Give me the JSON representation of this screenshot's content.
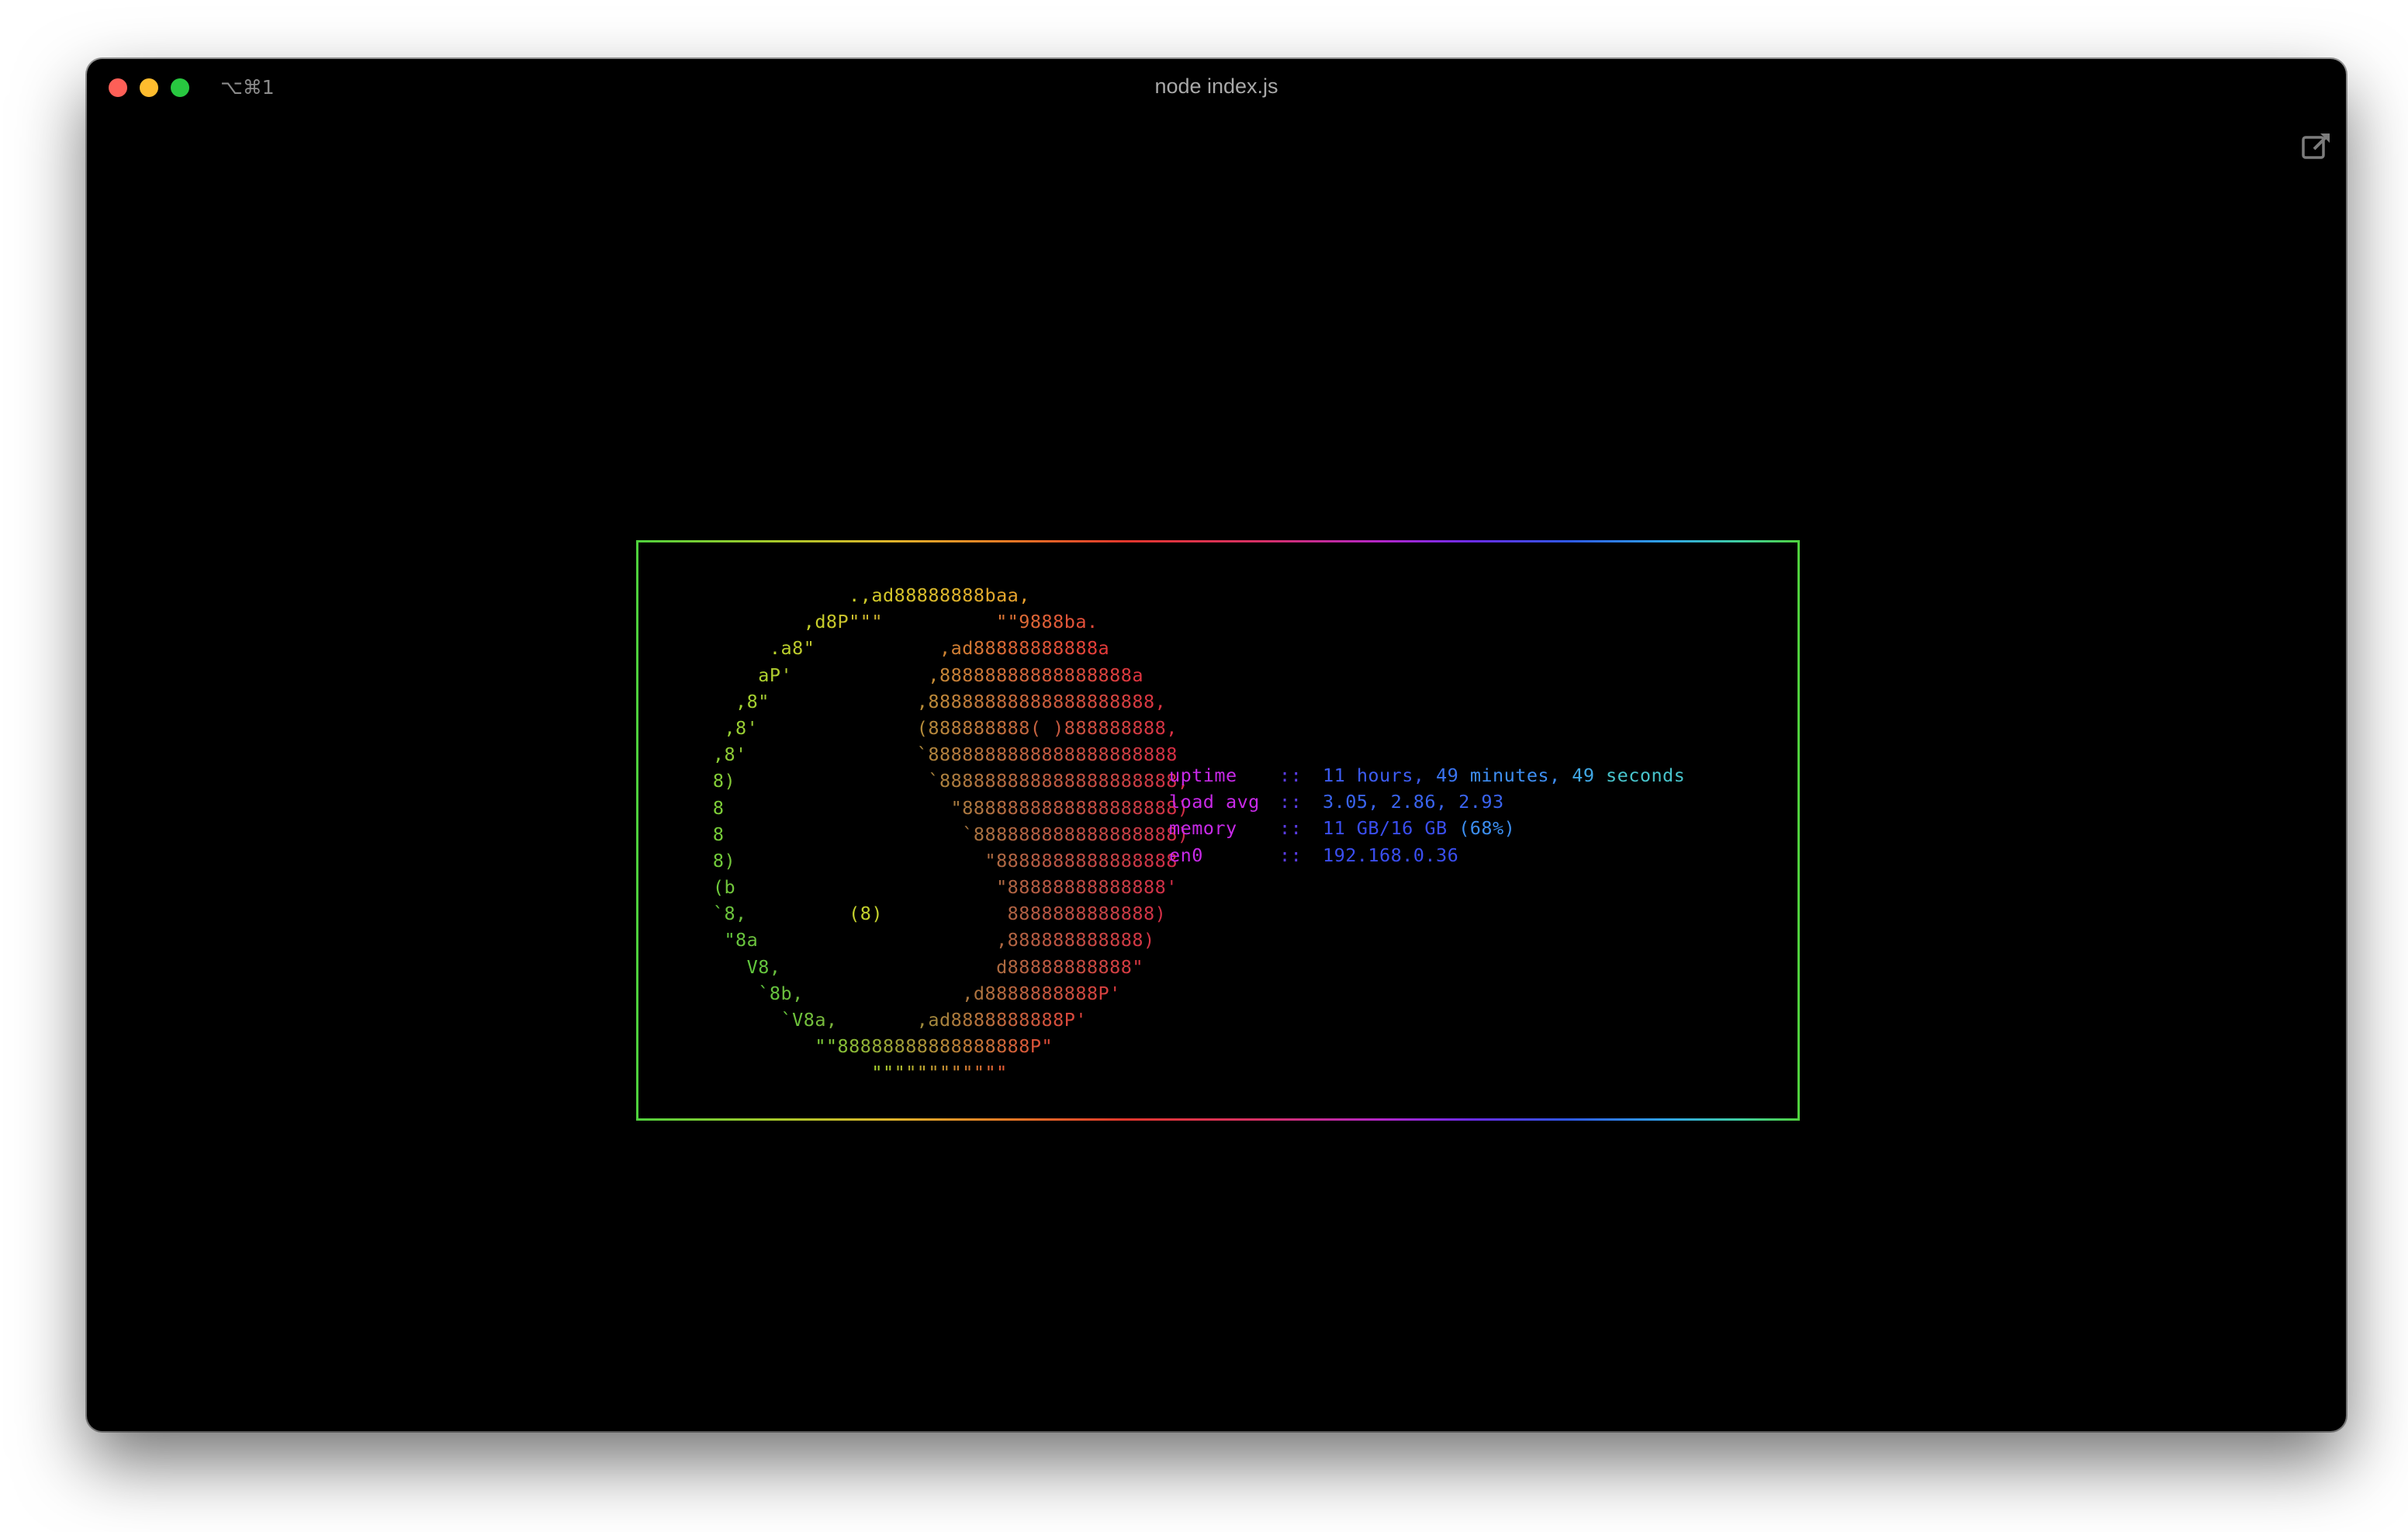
{
  "window": {
    "title": "node index.js",
    "shortcut": "⌥⌘1"
  },
  "logo": {
    "lines": [
      {
        "text": "               .,ad88888888baa,",
        "colors": [
          "#cfd12a",
          "#e9a02e"
        ]
      },
      {
        "text": "           ,d8P\"\"\"          \"\"9888ba.",
        "colors": [
          "#c7d42a",
          "#e4493a"
        ]
      },
      {
        "text": "        .a8\"           ,ad88888888888a",
        "colors": [
          "#b9d42c",
          "#e43a3a"
        ]
      },
      {
        "text": "       aP'            ,88888888888888888a",
        "colors": [
          "#aed22e",
          "#e03540"
        ]
      },
      {
        "text": "     ,8\"             ,88888888888888888888,",
        "colors": [
          "#a2d431",
          "#dc3242"
        ]
      },
      {
        "text": "    ,8'              (888888888( )888888888,",
        "colors": [
          "#97d233",
          "#d93044"
        ]
      },
      {
        "text": "   ,8'               `8888888888888888888888",
        "colors": [
          "#8dd035",
          "#d72f45"
        ]
      },
      {
        "text": "   8)                 `888888888888888888888,",
        "colors": [
          "#84ce37",
          "#d52e46"
        ]
      },
      {
        "text": "   8                    \"8888888888888888888)",
        "colors": [
          "#7dcd38",
          "#d42e47"
        ]
      },
      {
        "text": "   8                     `888888888888888888)",
        "colors": [
          "#77cc39",
          "#d42d48"
        ]
      },
      {
        "text": "   8)                      \"8888888888888888",
        "colors": [
          "#72cb3a",
          "#d42d48"
        ]
      },
      {
        "text": "   (b                       \"88888888888888'",
        "colors": [
          "#6eca3b",
          "#d42d48"
        ]
      },
      {
        "text": "   `8,         (8)           8888888888888)",
        "colors": [
          "#69c93c",
          "#d43047"
        ]
      },
      {
        "text": "    \"8a                     ,888888888888)",
        "colors": [
          "#65c83d",
          "#d63445"
        ]
      },
      {
        "text": "      V8,                   d88888888888\"",
        "colors": [
          "#62c83e",
          "#d83843"
        ]
      },
      {
        "text": "       `8b,              ,d8888888888P'",
        "colors": [
          "#63c83e",
          "#db3d40"
        ]
      },
      {
        "text": "         `V8a,       ,ad8888888888P'",
        "colors": [
          "#6ac93c",
          "#de443d"
        ]
      },
      {
        "text": "            \"\"88888888888888888P\"",
        "colors": [
          "#7dcc37",
          "#e14e39"
        ]
      },
      {
        "text": "                 \"\"\"\"\"\"\"\"\"\"\"\"",
        "colors": [
          "#a9d22f",
          "#e45d34"
        ]
      }
    ],
    "eye_segment": {
      "line": 12,
      "text": "(8)",
      "color": "#c4d12d"
    }
  },
  "stats": {
    "uptime": {
      "label": "uptime",
      "sep": "::",
      "hours": "11",
      "hours_word": "hours,",
      "minutes": "49",
      "minutes_word": "minutes,",
      "seconds": "49",
      "seconds_word": "seconds"
    },
    "load": {
      "label": "load avg",
      "sep": "::",
      "value": "3.05, 2.86, 2.93"
    },
    "memory": {
      "label": "memory",
      "sep": "::",
      "used": "11 GB/16 GB",
      "percent": "(68%)"
    },
    "network": {
      "label": "en0",
      "sep": "::",
      "value": "192.168.0.36"
    }
  },
  "colors": {
    "background": "#000000",
    "label": "#c829e8",
    "separator": "#5a3ce6"
  }
}
